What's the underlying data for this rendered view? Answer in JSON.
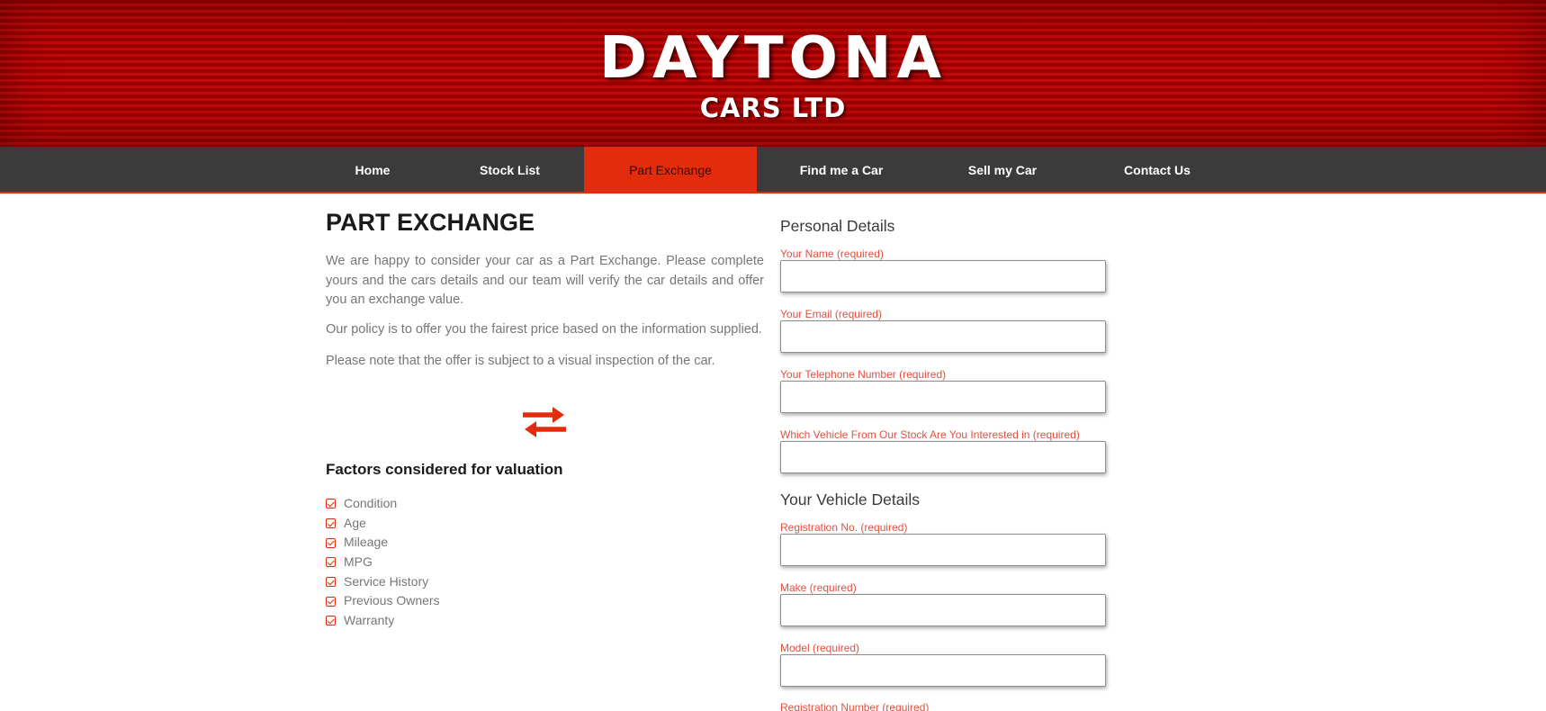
{
  "brand": {
    "name": "DAYTONA",
    "subtitle": "CARS LTD",
    "primary_color": "#e32b0d",
    "nav_bg": "#3b3b3b"
  },
  "nav": {
    "items": [
      {
        "label": "Home",
        "active": false
      },
      {
        "label": "Stock List",
        "active": false
      },
      {
        "label": "Part Exchange",
        "active": true
      },
      {
        "label": "Find me a Car",
        "active": false
      },
      {
        "label": "Sell my Car",
        "active": false
      },
      {
        "label": "Contact Us",
        "active": false
      }
    ]
  },
  "main": {
    "title": "PART EXCHANGE",
    "intro": "We are happy to consider your car as a Part Exchange. Please complete yours and the cars details and our team will verify the car details and offer you an exchange value.",
    "policy": "Our policy is to offer you the fairest price based on the information supplied.",
    "note": "Please note that the offer is subject to a visual inspection of the car.",
    "icon": "exchange-arrows-icon",
    "factors_title": "Factors considered for valuation",
    "factors": [
      "Condition",
      "Age",
      "Mileage",
      "MPG",
      "Service History",
      "Previous Owners",
      "Warranty"
    ]
  },
  "form": {
    "personal_title": "Personal Details",
    "personal_fields": [
      {
        "label": "Your Name (required)",
        "value": ""
      },
      {
        "label": "Your Email (required)",
        "value": ""
      },
      {
        "label": "Your Telephone Number (required)",
        "value": ""
      },
      {
        "label": "Which Vehicle From Our Stock Are You Interested in (required)",
        "value": ""
      }
    ],
    "vehicle_title": "Your Vehicle Details",
    "vehicle_fields": [
      {
        "label": "Registration No. (required)",
        "value": ""
      },
      {
        "label": "Make (required)",
        "value": ""
      },
      {
        "label": "Model (required)",
        "value": ""
      },
      {
        "label": "Registration Number (required)",
        "value": ""
      }
    ]
  }
}
